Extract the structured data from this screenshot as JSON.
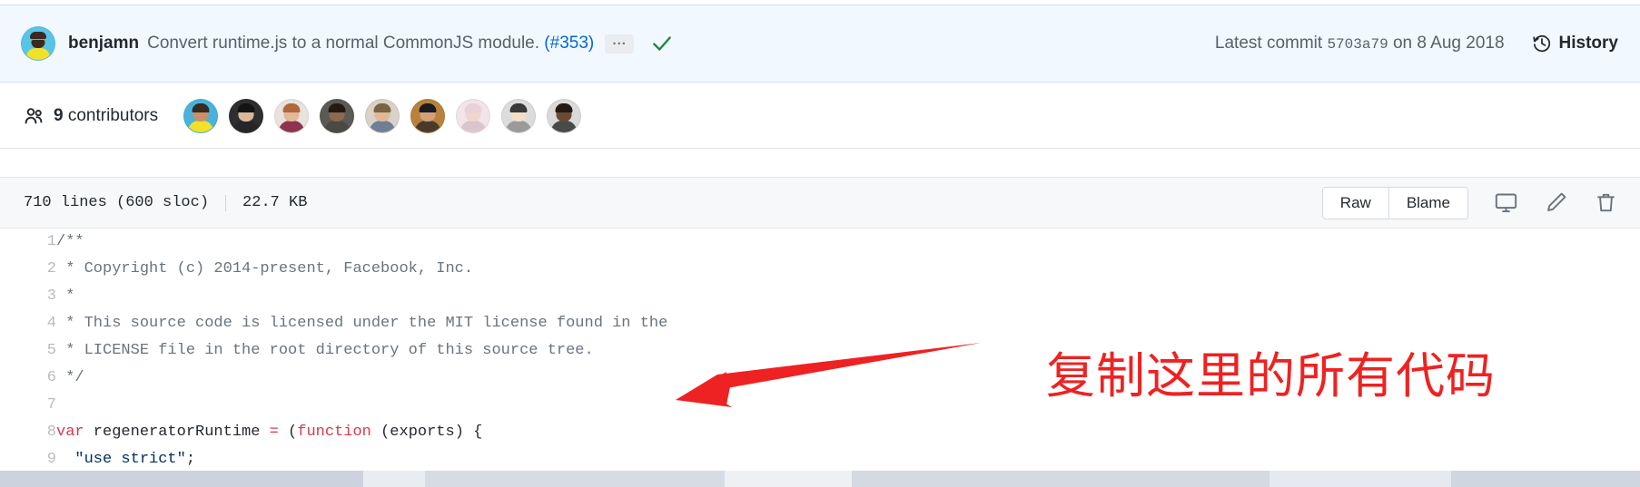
{
  "commit_header": {
    "author": "benjamn",
    "message": "Convert runtime.js to a normal CommonJS module.",
    "pr_ref": "(#353)",
    "expand_label": "...",
    "status_icon": "check-icon",
    "latest_commit_label": "Latest commit",
    "sha": "5703a79",
    "date": "on 8 Aug 2018",
    "history_label": "History"
  },
  "contributors": {
    "icon": "people-icon",
    "count": "9",
    "label": "contributors",
    "avatars": [
      {
        "bg": "#4ab3dd",
        "hair": "#3a2a20",
        "face": "#c9906a",
        "body": "#f3e02a"
      },
      {
        "bg": "#2e2e30",
        "hair": "#141414",
        "face": "#d8b79a",
        "body": "#262628"
      },
      {
        "bg": "#e8e3dd",
        "hair": "#b0673c",
        "face": "#e2b79a",
        "body": "#8e3350"
      },
      {
        "bg": "#5c5a55",
        "hair": "#241a14",
        "face": "#8b6a4f",
        "body": "#4a4944"
      },
      {
        "bg": "#d8d2c8",
        "hair": "#7a6243",
        "face": "#e0b896",
        "body": "#6f7f95"
      },
      {
        "bg": "#b8823c",
        "hair": "#1c1c20",
        "face": "#d4a077",
        "body": "#4a3a2c"
      },
      {
        "bg": "#f3e4ea",
        "hair": "#e8d2d8",
        "face": "#f0d6cc",
        "body": "#dcc4cc"
      },
      {
        "bg": "#dcdcdc",
        "hair": "#3a3a3a",
        "face": "#f2dfc8",
        "body": "#9a9a9a"
      },
      {
        "bg": "#dadada",
        "hair": "#241a14",
        "face": "#6b4a32",
        "body": "#4a4a4a"
      }
    ]
  },
  "file_header": {
    "lines_info": "710 lines (600 sloc)",
    "size": "22.7 KB",
    "raw_label": "Raw",
    "blame_label": "Blame",
    "desktop_icon": "desktop-download-icon",
    "edit_icon": "pencil-icon",
    "delete_icon": "trash-icon"
  },
  "code": {
    "language": "javascript",
    "lines": [
      {
        "n": "1",
        "tokens": [
          {
            "t": "/**",
            "c": "c-com"
          }
        ]
      },
      {
        "n": "2",
        "tokens": [
          {
            "t": " * Copyright (c) 2014-present, Facebook, Inc.",
            "c": "c-com"
          }
        ]
      },
      {
        "n": "3",
        "tokens": [
          {
            "t": " *",
            "c": "c-com"
          }
        ]
      },
      {
        "n": "4",
        "tokens": [
          {
            "t": " * This source code is licensed under the MIT license found in the",
            "c": "c-com"
          }
        ]
      },
      {
        "n": "5",
        "tokens": [
          {
            "t": " * LICENSE file in the root directory of this source tree.",
            "c": "c-com"
          }
        ]
      },
      {
        "n": "6",
        "tokens": [
          {
            "t": " */",
            "c": "c-com"
          }
        ]
      },
      {
        "n": "7",
        "tokens": [
          {
            "t": "",
            "c": ""
          }
        ]
      },
      {
        "n": "8",
        "tokens": [
          {
            "t": "var",
            "c": "c-key"
          },
          {
            "t": " regeneratorRuntime ",
            "c": ""
          },
          {
            "t": "=",
            "c": "c-key"
          },
          {
            "t": " (",
            "c": ""
          },
          {
            "t": "function",
            "c": "c-key"
          },
          {
            "t": " (exports) {",
            "c": ""
          }
        ]
      },
      {
        "n": "9",
        "tokens": [
          {
            "t": "  ",
            "c": ""
          },
          {
            "t": "\"use strict\"",
            "c": "c-str"
          },
          {
            "t": ";",
            "c": ""
          }
        ]
      }
    ]
  },
  "annotation": {
    "text": "复制这里的所有代码",
    "color": "#ee2222",
    "arrow": "red-arrow-pointing-left"
  },
  "colors": {
    "header_bg": "#f1f8ff",
    "header_border": "#c8e1ff",
    "file_header_bg": "#f6f8fa",
    "link": "#0366d6",
    "muted": "#586069",
    "keyword": "#d73a49",
    "comment": "#6a737d",
    "string": "#032f62",
    "check_green": "#22863a"
  }
}
